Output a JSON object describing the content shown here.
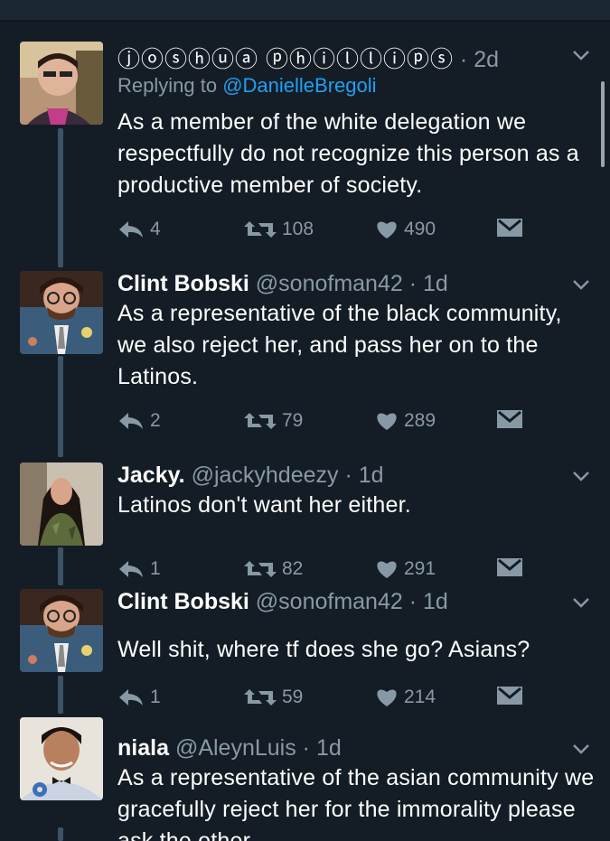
{
  "tweets": [
    {
      "name": "ⓙⓞⓢⓗⓤⓐ ⓟⓗⓘⓛⓛⓘⓟⓢ",
      "handle": "",
      "time": "2d",
      "replying_label": "Replying to",
      "replying_to": "@DanielleBregoli",
      "text": "As a member of the white delegation we respectfully do not recognize this person as a productive member of society.",
      "replies": "4",
      "retweets": "108",
      "likes": "490"
    },
    {
      "name": "Clint Bobski",
      "handle": "@sonofman42",
      "time": "1d",
      "text": "As a representative of the black community, we also reject her, and pass her on to the Latinos.",
      "replies": "2",
      "retweets": "79",
      "likes": "289"
    },
    {
      "name": "Jacky.",
      "handle": "@jackyhdeezy",
      "time": "1d",
      "text": "Latinos don't want her either.",
      "replies": "1",
      "retweets": "82",
      "likes": "291"
    },
    {
      "name": "Clint Bobski",
      "handle": "@sonofman42",
      "time": "1d",
      "text": "Well shit, where tf does she go? Asians?",
      "replies": "1",
      "retweets": "59",
      "likes": "214"
    },
    {
      "name": "niala",
      "handle": "@AleynLuis",
      "time": "1d",
      "text": "As a representative of the asian community we gracefully reject her for the immorality please ask the other"
    }
  ],
  "separator": "·",
  "colors": {
    "background": "#141d26",
    "muted": "#8899a6",
    "link": "#1da1f2",
    "thread_line": "#3d5466"
  },
  "icons": [
    "reply-icon",
    "retweet-icon",
    "like-icon",
    "direct-message-icon",
    "chevron-down-icon"
  ]
}
